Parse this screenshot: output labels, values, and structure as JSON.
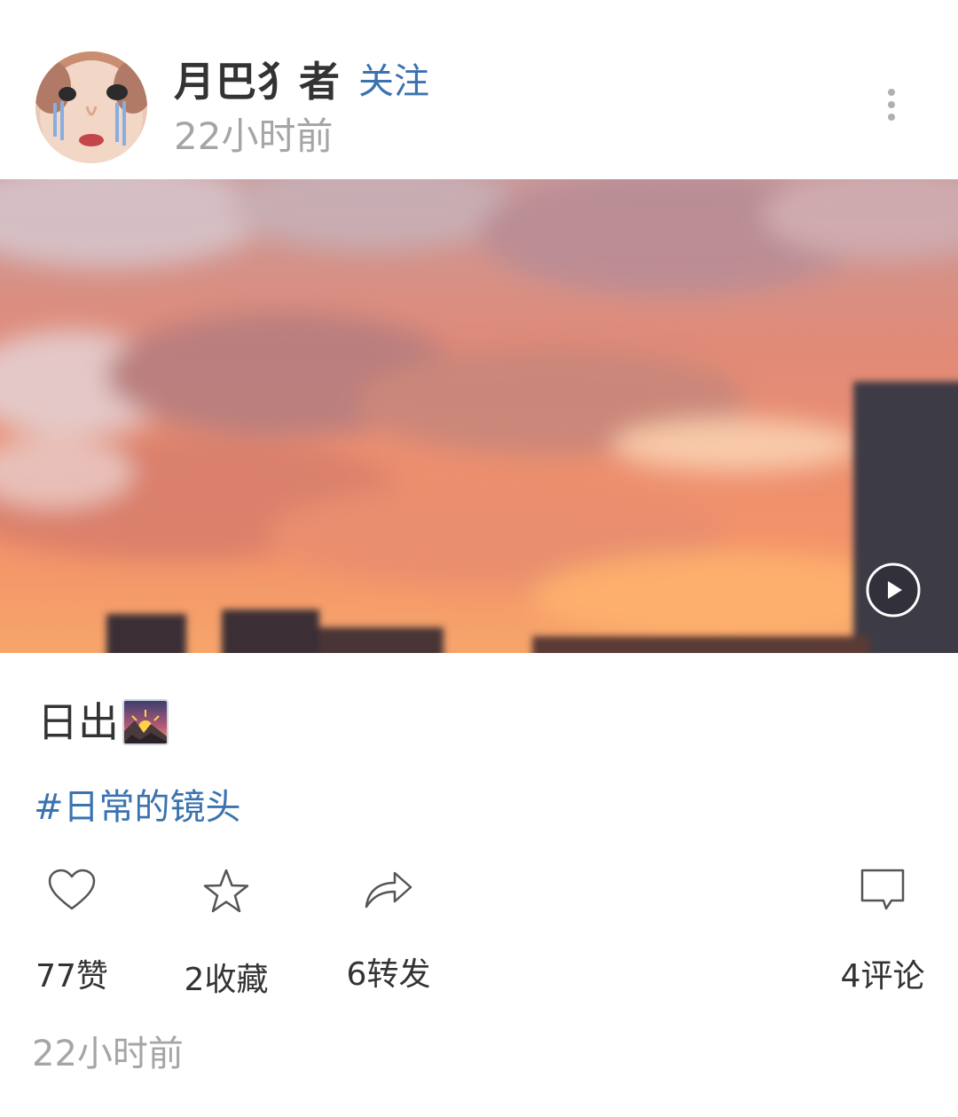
{
  "post": {
    "author": {
      "name": "月巴犭者",
      "avatar_icon": "avatar-photo-icon"
    },
    "follow_label": "关注",
    "time": "22小时前",
    "more_icon": "more-vertical-icon",
    "media": {
      "type": "video",
      "play_icon": "play-icon"
    },
    "caption": "日出",
    "caption_emoji": "sunrise-over-mountains-icon",
    "hashtag": "#日常的镜头",
    "actions": {
      "like": {
        "icon": "heart-icon",
        "label": "77赞"
      },
      "favorite": {
        "icon": "star-icon",
        "label": "2收藏"
      },
      "repost": {
        "icon": "share-arrow-icon",
        "label": "6转发"
      },
      "comment": {
        "icon": "comment-icon",
        "label": "4评论"
      }
    },
    "footer_time": "22小时前"
  },
  "colors": {
    "link": "#3a73b0",
    "meta_gray": "#a5a5a5",
    "text": "#333333"
  }
}
